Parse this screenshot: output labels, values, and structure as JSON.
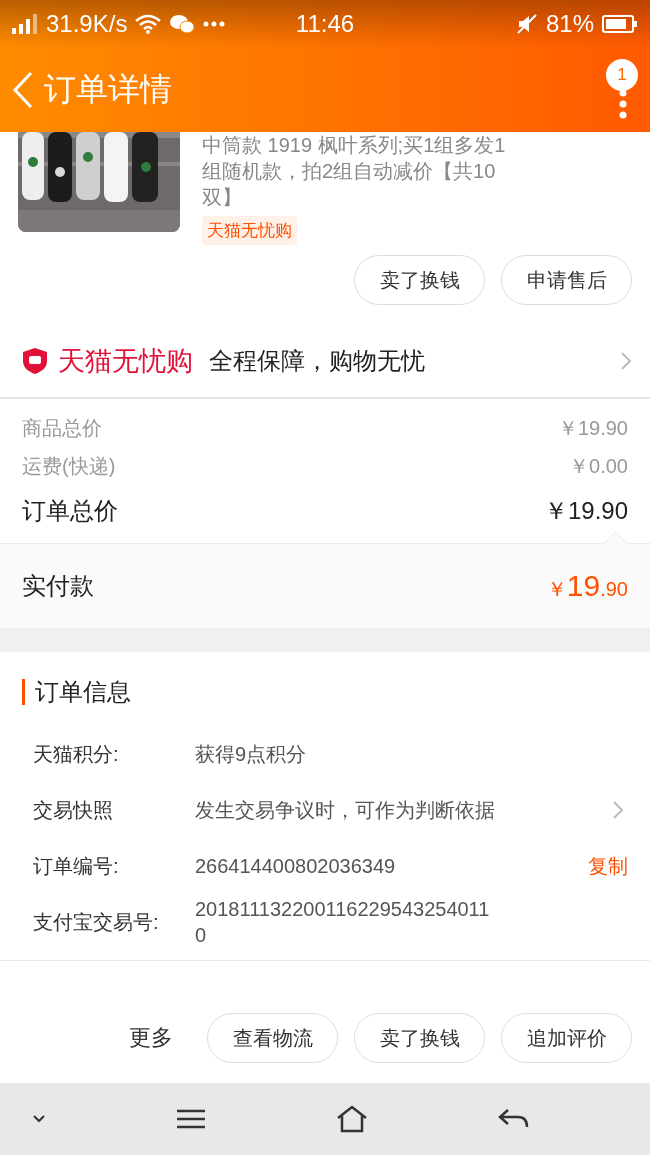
{
  "status_bar": {
    "network_speed": "31.9K/s",
    "time": "11:46",
    "battery": "81%"
  },
  "header": {
    "title": "订单详情",
    "badge": "1"
  },
  "product": {
    "image": {
      "kind": "picture"
    },
    "title_lines": [
      "中筒款 1919 枫叶系列;买1组多发1",
      "组随机款，拍2组自动减价【共10",
      "双】"
    ],
    "tag": "天猫无忧购"
  },
  "item_actions": [
    "卖了换钱",
    "申请售后"
  ],
  "guarantee": {
    "brand": "天猫无忧购",
    "text": "全程保障，购物无忧"
  },
  "price_rows": [
    {
      "label": "商品总价",
      "value": "￥19.90",
      "kind": "minor"
    },
    {
      "label": "运费(快递)",
      "value": "￥0.00",
      "kind": "minor"
    },
    {
      "label": "订单总价",
      "value": "￥19.90",
      "kind": "total"
    }
  ],
  "payment": {
    "label": "实付款",
    "currency": "￥",
    "integer": "19",
    "decimal": ".90"
  },
  "order_info": {
    "title": "订单信息",
    "rows": [
      {
        "label": "天猫积分:",
        "value": "获得9点积分",
        "kind": "plain"
      },
      {
        "label": "交易快照",
        "value": "发生交易争议时，可作为判断依据",
        "kind": "link"
      },
      {
        "label": "订单编号:",
        "value": "266414400802036349",
        "kind": "copy",
        "action": "复制"
      },
      {
        "label": "支付宝交易号:",
        "value": "2018111322001162295432540110",
        "kind": "plain"
      }
    ]
  },
  "footer": {
    "more": "更多",
    "buttons": [
      "查看物流",
      "卖了换钱",
      "追加评价"
    ]
  }
}
